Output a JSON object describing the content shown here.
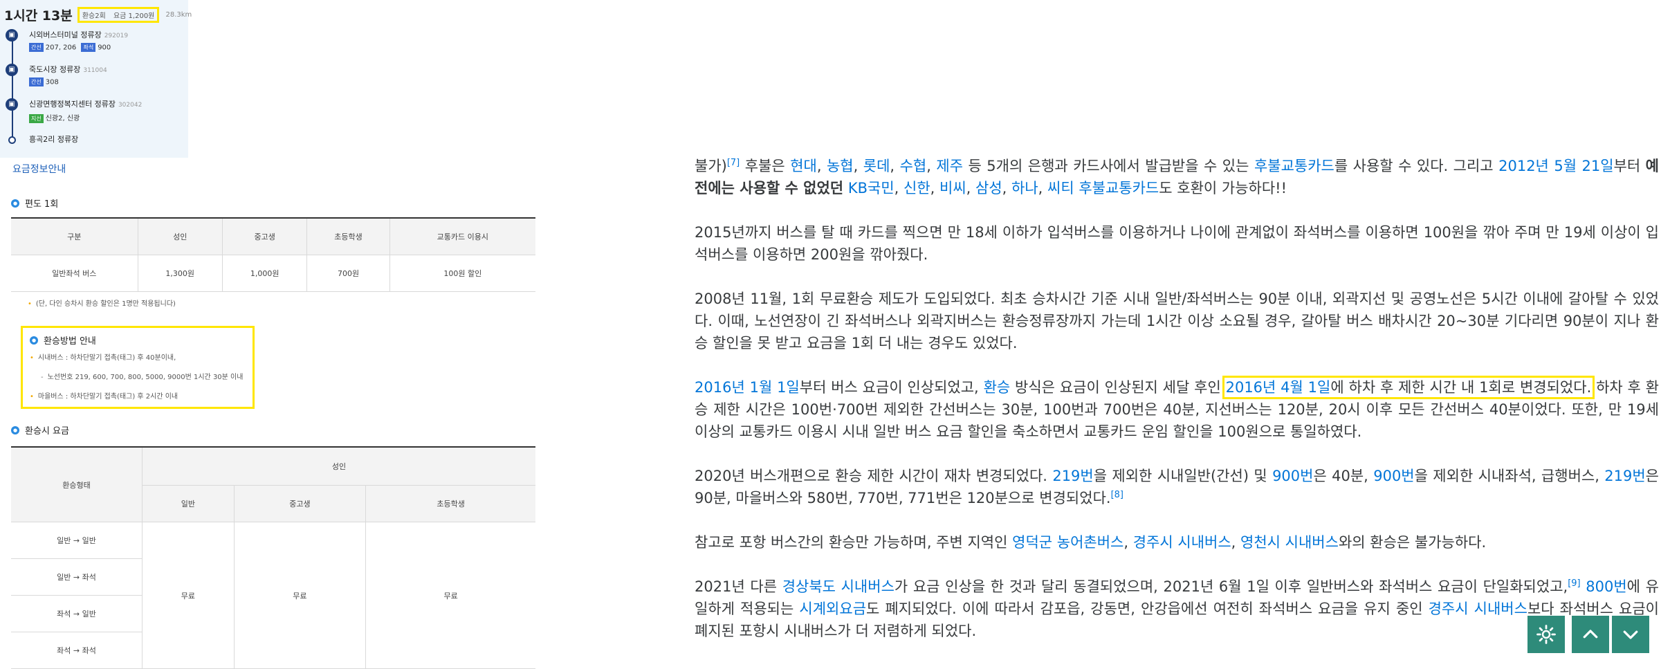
{
  "route": {
    "time": "1시간 13분",
    "transfers": "환승2회",
    "fare": "요금 1,200원",
    "distance": "28.3km",
    "stops": [
      {
        "name": "시외버스터미널 정류장",
        "code": "292019",
        "lines": [
          {
            "tag": "간선",
            "color": "#3b6cd4",
            "routes": "207, 206"
          },
          {
            "tag": "좌석",
            "color": "#3b6cd4",
            "routes": "900"
          }
        ]
      },
      {
        "name": "죽도시장 정류장",
        "code": "311004",
        "lines": [
          {
            "tag": "간선",
            "color": "#3b6cd4",
            "routes": "308"
          }
        ]
      },
      {
        "name": "신광면행정복지센터 정류장",
        "code": "302042",
        "lines": [
          {
            "tag": "지선",
            "color": "#3aa845",
            "routes": "신광2, 신광"
          }
        ]
      },
      {
        "name": "흥곡2리 정류장",
        "code": "",
        "lines": []
      }
    ]
  },
  "fare_link": "요금정보안내",
  "one_way": {
    "title": "편도 1회",
    "headers": [
      "구분",
      "성인",
      "중고생",
      "초등학생",
      "교통카드 이용시"
    ],
    "row": [
      "일반좌석 버스",
      "1,300원",
      "1,000원",
      "700원",
      "100원 할인"
    ],
    "note": "(단, 다인 승차시 환승 할인은 1명만 적용됩니다)"
  },
  "transfer_method": {
    "title": "환승방법 안내",
    "items": [
      "시내버스 : 하차단말기 접촉(태그) 후 40분이내,",
      "노선번호 219, 600, 700, 800, 5000, 9000번 1시간 30분 이내",
      "마을버스 : 하차단말기 접촉(태그) 후 2시간 이내"
    ]
  },
  "transfer_fare": {
    "title": "환승시 요금",
    "col_type": "환승형태",
    "group": "성인",
    "sub": [
      "일반",
      "중고생",
      "초등학생"
    ],
    "rows": [
      "일반 → 일반",
      "일반 → 좌석",
      "좌석 → 일반",
      "좌석 → 좌석"
    ],
    "free": [
      "무료",
      "무료",
      "무료"
    ]
  },
  "article": {
    "p1": {
      "a": "불가)",
      "ref": "[7]",
      "b": " 후불은 ",
      "banks": [
        "현대",
        "농협",
        "롯데",
        "수협",
        "제주"
      ],
      "c": " 등 5개의 은행과 카드사에서 발급받을 수 있는 ",
      "card_link": "후불교통카드",
      "d": "를 사용할 수 있다. 그리고 ",
      "date_link": "2012년 5월 21일",
      "e": "부터 ",
      "bold": "예전에는 사용할 수 없었던",
      "f": " ",
      "kb": "KB국민",
      "shinhan": "신한",
      "bc": "비씨",
      "samsung": "삼성",
      "hana": "하나",
      "citi": "씨티 후불교통카드",
      "g": "도 호환이 가능하다!!"
    },
    "p2": "2015년까지 버스를 탈 때 카드를 찍으면 만 18세 이하가 입석버스를 이용하거나 나이에 관계없이 좌석버스를 이용하면 100원을 깎아 주며 만 19세 이상이 입석버스를 이용하면 200원을 깎아줬다.",
    "p3": "2008년 11월, 1회 무료환승 제도가 도입되었다. 최초 승차시간 기준 시내 일반/좌석버스는 90분 이내, 외곽지선 및 공영노선은 5시간 이내에 갈아탈 수 있었다. 이때, 노선연장이 긴 좌석버스나 외곽지버스는 환승정류장까지 가는데 1시간 이상 소요될 경우, 갈아탈 버스 배차시간 20~30분 기다리면 90분이 지나 환승 할인을 못 받고 요금을 1회 더 내는 경우도 있었다.",
    "p4": {
      "date1": "2016년 1월 1일",
      "a": "부터 버스 요금이 인상되었고, ",
      "transfer_link": "환승",
      "b": " 방식은 요금이 인상된지 세달 후인 ",
      "date2": "2016년 4월 1일",
      "c": "에 하차 후 제한 시간 내 1회로 변경되었다.",
      "d": " 하차 후 환승 제한 시간은 100번·700번 제외한 간선버스는 30분, 100번과 700번은 40분, 지선버스는 120분, 20시 이후 모든 간선버스 40분이었다. 또한, 만 19세 이상의 교통카드 이용시 시내 일반 버스 요금 할인을 축소하면서 교통카드 운임 할인을 100원으로 통일하였다."
    },
    "p5": {
      "a": "2020년 버스개편으로 환승 제한 시간이 재차 변경되었다. ",
      "l1": "219번",
      "b": "을 제외한 시내일반(간선) 및 ",
      "l2": "900번",
      "c": "은 40분, ",
      "l3": "900번",
      "d": "을 제외한 시내좌석, 급행버스, ",
      "l4": "219번",
      "e": "은 90분, 마을버스와 580번, 770번, 771번은 120분으로 변경되었다.",
      "ref": "[8]"
    },
    "p6": {
      "a": "참고로 포항 버스간의 환승만 가능하며, 주변 지역인 ",
      "l1": "영덕군 농어촌버스",
      "l2": "경주시 시내버스",
      "l3": "영천시 시내버스",
      "b": "와의 환승은 불가능하다."
    },
    "p7": {
      "a": "2021년 다른 ",
      "l1": "경상북도 시내버스",
      "b": "가 요금 인상을 한 것과 달리 동결되었으며, 2021년 6월 1일 이후 일반버스와 좌석버스 요금이 단일화되었고,",
      "ref": "[9]",
      "l2": "800번",
      "c": "에 유일하게 적용되는 ",
      "l3": "시계외요금",
      "d": "도 폐지되었다. 이에 따라서 감포읍, 강동면, 안강읍에선 여전히 좌석버스 요금을 유지 중인 ",
      "l4": "경주시 시내버스",
      "e": "보다 좌석버스 요금이 폐지된 포항시 시내버스가 더 저렴하게 되었다."
    }
  },
  "buttons": {
    "settings": "settings-icon",
    "up": "chevron-up-icon",
    "down": "chevron-down-icon"
  },
  "colors": {
    "link": "#0275d8",
    "highlight": "#ffe600",
    "fab": "#2e8b7a",
    "route": "#1d3e7a"
  }
}
